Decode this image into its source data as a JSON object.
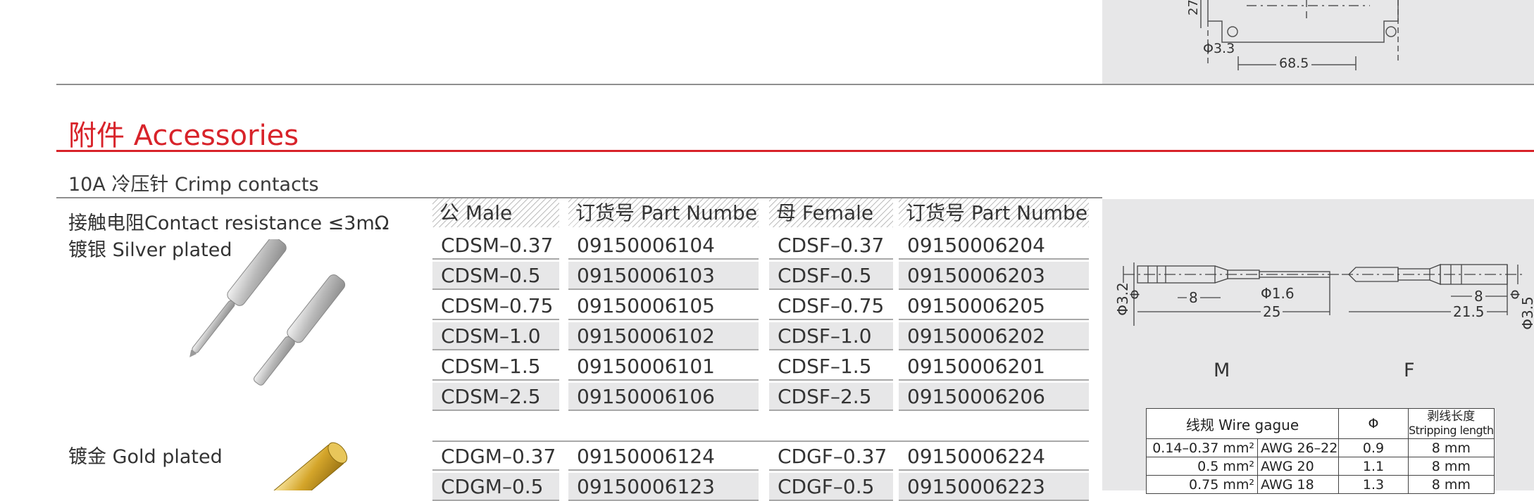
{
  "top_drawing": {
    "dim_height": "27",
    "dim_phi": "Φ3.3",
    "dim_width": "68.5"
  },
  "section": {
    "title": "附件 Accessories",
    "subtitle": "10A 冷压针 Crimp contacts"
  },
  "left_notes": {
    "contact_resistance": "接触电阻Contact resistance ≤3mΩ",
    "silver": "镀银 Silver plated",
    "gold": "镀金 Gold plated"
  },
  "table": {
    "headers": [
      "公 Male",
      "订货号 Part Number",
      "母 Female",
      "订货号 Part Number"
    ],
    "silver_rows": [
      [
        "CDSM–0.37",
        "09150006104",
        "CDSF–0.37",
        "09150006204"
      ],
      [
        "CDSM–0.5",
        "09150006103",
        "CDSF–0.5",
        "09150006203"
      ],
      [
        "CDSM–0.75",
        "09150006105",
        "CDSF–0.75",
        "09150006205"
      ],
      [
        "CDSM–1.0",
        "09150006102",
        "CDSF–1.0",
        "09150006202"
      ],
      [
        "CDSM–1.5",
        "09150006101",
        "CDSF–1.5",
        "09150006201"
      ],
      [
        "CDSM–2.5",
        "09150006106",
        "CDSF–2.5",
        "09150006206"
      ]
    ],
    "gold_rows": [
      [
        "CDGM–0.37",
        "09150006124",
        "CDGF–0.37",
        "09150006224"
      ],
      [
        "CDGM–0.5",
        "09150006123",
        "CDGF–0.5",
        "09150006223"
      ]
    ]
  },
  "contact_drawing": {
    "male": {
      "phi_outer": "Φ3.2",
      "phi_mark": "Φ",
      "len_8": "8",
      "len_25": "25",
      "phi_pin": "Φ1.6",
      "label": "M"
    },
    "female": {
      "phi_outer": "Φ3.5",
      "phi_mark": "Φ",
      "len_8": "8",
      "len_21_5": "21.5",
      "label": "F"
    }
  },
  "spec_table": {
    "header_wire": "线规 Wire gague",
    "header_phi": "Φ",
    "header_strip_cn": "剥线长度",
    "header_strip_en": "Stripping length",
    "rows": [
      {
        "mm": "0.14–0.37 mm²",
        "awg": "AWG 26–22",
        "phi": "0.9",
        "strip": "8 mm"
      },
      {
        "mm": "0.5 mm²",
        "awg": "AWG 20",
        "phi": "1.1",
        "strip": "8 mm"
      },
      {
        "mm": "0.75 mm²",
        "awg": "AWG 18",
        "phi": "1.3",
        "strip": "8 mm"
      }
    ]
  },
  "colors": {
    "accent_red": "#d8232a",
    "panel_gray": "#e7e7e8",
    "silver": "#c9c9c9",
    "gold": "#d4a52a"
  }
}
